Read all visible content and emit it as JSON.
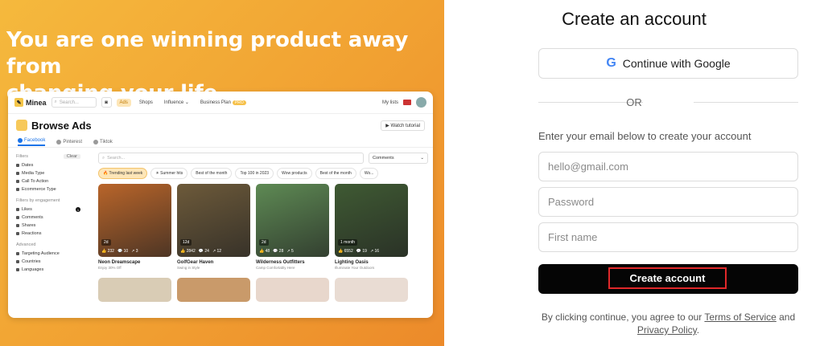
{
  "hero": {
    "line1": "You are one winning product away from",
    "line2": "changing your life."
  },
  "preview": {
    "logo": "Minea",
    "search_placeholder": "Search...",
    "nav": [
      "Ads",
      "Shops",
      "Influence ⌄",
      "Business Plan"
    ],
    "pro_badge": "PRO",
    "my_lists": "My lists",
    "page_title": "Browse Ads",
    "watch_tutorial": "▶ Watch tutorial",
    "platforms": [
      "Facebook",
      "Pinterest",
      "Tiktok"
    ],
    "filters_label": "Filters",
    "clear_label": "Clear",
    "filters": [
      "Dates",
      "Media Type",
      "Call To Action",
      "Ecommerce Type"
    ],
    "engagement_label": "Filters by engagement",
    "engagement": [
      "Likes",
      "Comments",
      "Shares",
      "Reactions"
    ],
    "likes_badge": "1",
    "advanced_label": "Advanced",
    "advanced": [
      "Targeting Audience",
      "Countries",
      "Languages"
    ],
    "main_search": "Search...",
    "sort_label": "Comments",
    "chips": [
      "🔥 Trending last week",
      "☀ Summer hits",
      "Best of the month",
      "Top 100 in 2023",
      "Wow products",
      "Best of the month",
      "Wo..."
    ],
    "cards": [
      {
        "title": "Neon Dreamscape",
        "sub": "Enjoy 30% Off",
        "date": "2d",
        "stats": [
          "👍 232",
          "💬 10",
          "↗ 3"
        ],
        "color": "#b9652a"
      },
      {
        "title": "GolfGear Haven",
        "sub": "Swing in Style",
        "date": "12d",
        "stats": [
          "👍 2842",
          "💬 24",
          "↗ 12"
        ],
        "color": "#6d5a3a"
      },
      {
        "title": "Wilderness Outfitters",
        "sub": "Camp Comfortably Here",
        "date": "2d",
        "stats": [
          "👍 48",
          "💬 28",
          "↗ 5"
        ],
        "color": "#5e8a54"
      },
      {
        "title": "Lighting Oasis",
        "sub": "Illuminate Your Outdoors",
        "date": "1 month",
        "stats": [
          "👍 6552",
          "💬 19",
          "↗ 16"
        ],
        "color": "#3f5a33"
      }
    ],
    "row2_colors": [
      "#d9ccb5",
      "#c99a6a",
      "#e8d7cc",
      "#e9dcd3"
    ]
  },
  "signup": {
    "title": "Create an account",
    "google_label": "Continue with Google",
    "or": "OR",
    "hint": "Enter your email below to create your account",
    "email_placeholder": "hello@gmail.com",
    "password_placeholder": "Password",
    "firstname_placeholder": "First name",
    "create_label": "Create account",
    "terms_prefix": "By clicking continue, you agree to our ",
    "terms_link": "Terms of Service",
    "terms_and": " and ",
    "privacy_link": "Privacy Policy",
    "terms_suffix": "."
  }
}
